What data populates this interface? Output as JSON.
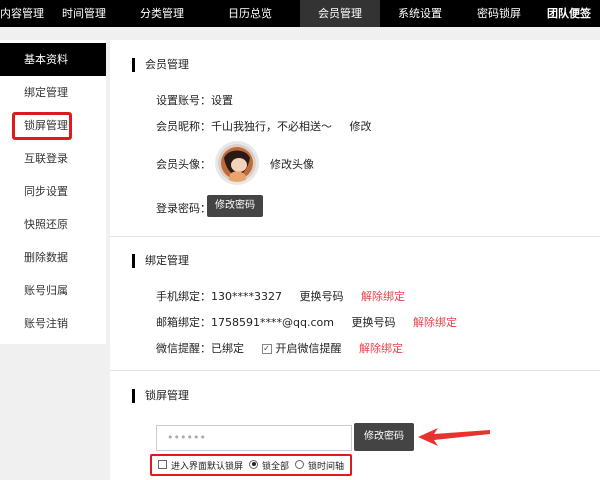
{
  "topnav": {
    "tabs": [
      "内容管理",
      "时间管理",
      "分类管理",
      "日历总览",
      "会员管理",
      "系统设置",
      "密码锁屏",
      "团队便签"
    ],
    "active_index": 4
  },
  "sidebar": {
    "items": [
      "基本资料",
      "绑定管理",
      "锁屏管理",
      "互联登录",
      "同步设置",
      "快照还原",
      "删除数据",
      "账号归属",
      "账号注销"
    ],
    "active_index": 0,
    "highlighted_index": 2
  },
  "member": {
    "title": "会员管理",
    "account_label": "设置账号：",
    "account_value": "设置",
    "nickname_label": "会员昵称：",
    "nickname_value": "千山我独行，不必相送～",
    "nickname_edit": "修改",
    "avatar_label": "会员头像：",
    "avatar_edit": "修改头像",
    "password_label": "登录密码：",
    "password_button": "修改密码"
  },
  "binding": {
    "title": "绑定管理",
    "phone_label": "手机绑定：",
    "phone_value": "130****3327",
    "phone_change": "更换号码",
    "phone_unbind": "解除绑定",
    "email_label": "邮箱绑定：",
    "email_value": "1758591****@qq.com",
    "email_change": "更换号码",
    "email_unbind": "解除绑定",
    "wechat_label": "微信提醒：",
    "wechat_value": "已绑定",
    "wechat_check": "开启微信提醒",
    "wechat_check_checked": true,
    "wechat_unbind": "解除绑定"
  },
  "lockscreen": {
    "title": "锁屏管理",
    "password_placeholder": "••••••",
    "button": "修改密码",
    "option_default_lock": "进入界面默认锁屏",
    "option_default_lock_checked": false,
    "radio_lock_all": "锁全部",
    "radio_lock_timeline": "锁时间轴",
    "radio_selected": "锁全部"
  },
  "colors": {
    "accent_red": "#e0191d",
    "link_red": "#e8434a",
    "nav_bg": "#000000",
    "arrow": "#e8322f"
  }
}
